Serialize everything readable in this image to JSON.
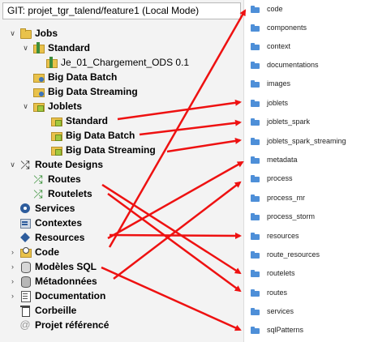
{
  "git_bar": "GIT: projet_tgr_talend/feature1   (Local Mode)",
  "tree": {
    "jobs": "Jobs",
    "jobs_standard": "Standard",
    "job_file": "Je_01_Chargement_ODS 0.1",
    "big_data_batch": "Big Data Batch",
    "big_data_streaming": "Big Data Streaming",
    "joblets": "Joblets",
    "joblets_standard": "Standard",
    "joblets_big_data_batch": "Big Data Batch",
    "joblets_big_data_streaming": "Big Data Streaming",
    "route_designs": "Route Designs",
    "routes": "Routes",
    "routelets": "Routelets",
    "services": "Services",
    "contextes": "Contextes",
    "resources": "Resources",
    "code": "Code",
    "modeles_sql": "Modèles SQL",
    "metadonnees": "Métadonnées",
    "documentation": "Documentation",
    "corbeille": "Corbeille",
    "projet_reference": "Projet référencé"
  },
  "folders": [
    "code",
    "components",
    "context",
    "documentations",
    "images",
    "joblets",
    "joblets_spark",
    "joblets_spark_streaming",
    "metadata",
    "process",
    "process_mr",
    "process_storm",
    "resources",
    "route_resources",
    "routelets",
    "routes",
    "services",
    "sqlPatterns"
  ],
  "colors": {
    "arrow": "#ee1111",
    "folder_icon": "#4e8fd8",
    "left_bg": "#f3f3f3"
  }
}
